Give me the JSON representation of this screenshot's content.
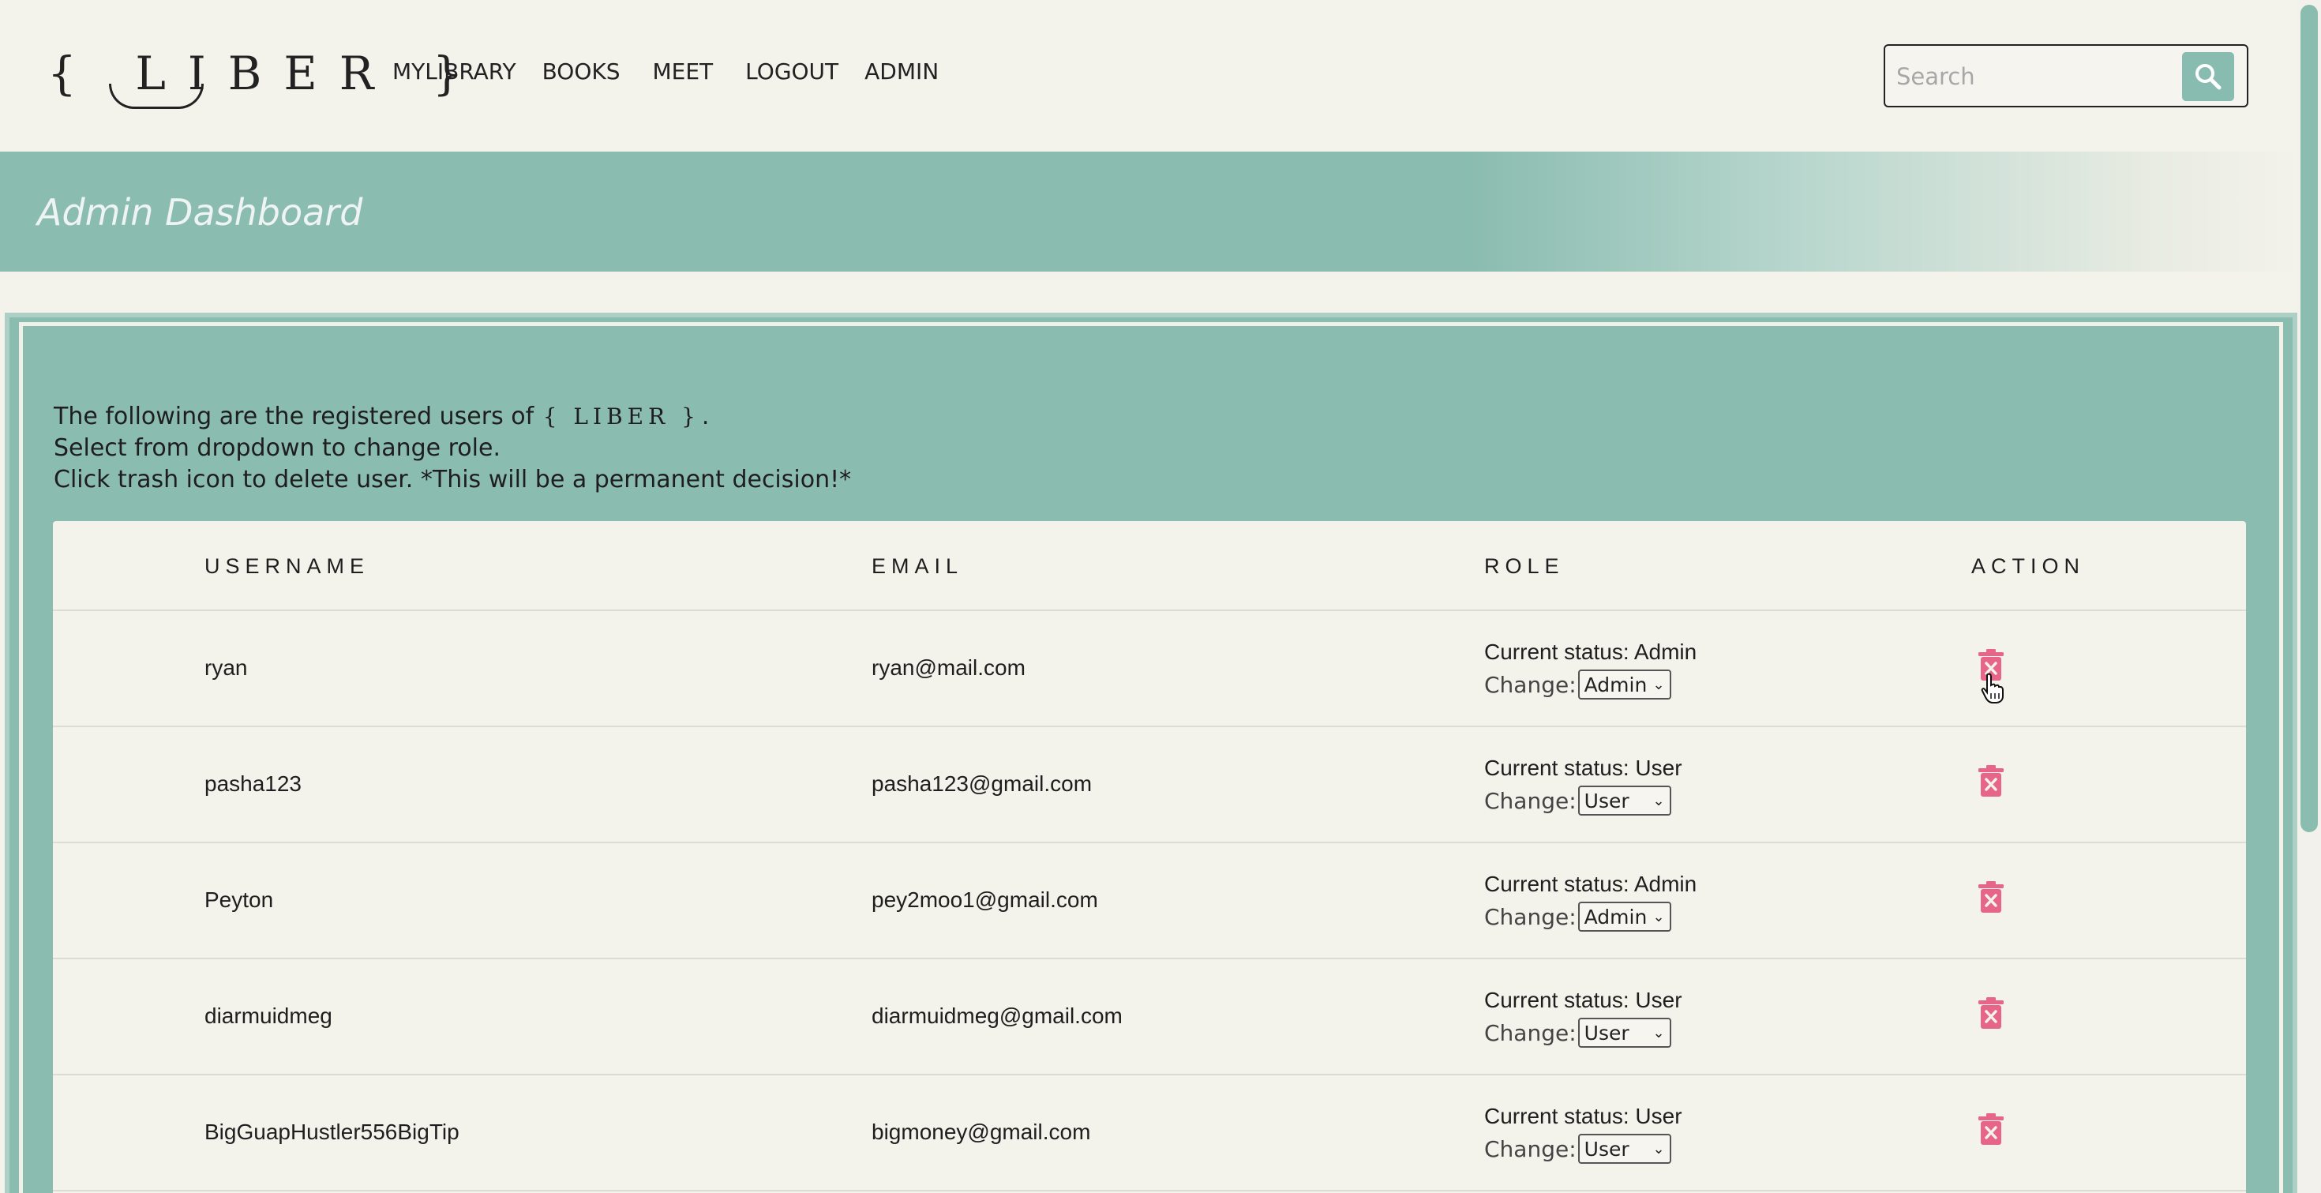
{
  "brand": {
    "logo_text": "{ LIBER }",
    "mini_logo_text": "{ LIBER }"
  },
  "nav": {
    "items": [
      {
        "label": "MYLIBRARY"
      },
      {
        "label": "BOOKS"
      },
      {
        "label": "MEET"
      },
      {
        "label": "LOGOUT"
      },
      {
        "label": "ADMIN"
      }
    ]
  },
  "search": {
    "placeholder": "Search",
    "icon": "search-icon"
  },
  "banner": {
    "title": "Admin Dashboard"
  },
  "intro": {
    "line1_prefix": "The following are the registered users of",
    "line1_suffix": ".",
    "line2": "Select from dropdown to change role.",
    "line3": "Click trash icon to delete user. *This will be a permanent decision!*"
  },
  "table": {
    "headers": {
      "username": "USERNAME",
      "email": "EMAIL",
      "role": "ROLE",
      "action": "ACTION"
    },
    "change_label": "Change:",
    "rows": [
      {
        "username": "ryan",
        "email": "ryan@mail.com",
        "status": "Current status: Admin",
        "role_selected": "Admin"
      },
      {
        "username": "pasha123",
        "email": "pasha123@gmail.com",
        "status": "Current status: User",
        "role_selected": "User"
      },
      {
        "username": "Peyton",
        "email": "pey2moo1@gmail.com",
        "status": "Current status: Admin",
        "role_selected": "Admin"
      },
      {
        "username": "diarmuidmeg",
        "email": "diarmuidmeg@gmail.com",
        "status": "Current status: User",
        "role_selected": "User"
      },
      {
        "username": "BigGuapHustler556BigTip",
        "email": "bigmoney@gmail.com",
        "status": "Current status: User",
        "role_selected": "User"
      }
    ]
  },
  "colors": {
    "accent_teal": "#8bbcb0",
    "background": "#f3f2eb",
    "trash_pink": "#e8658a"
  }
}
